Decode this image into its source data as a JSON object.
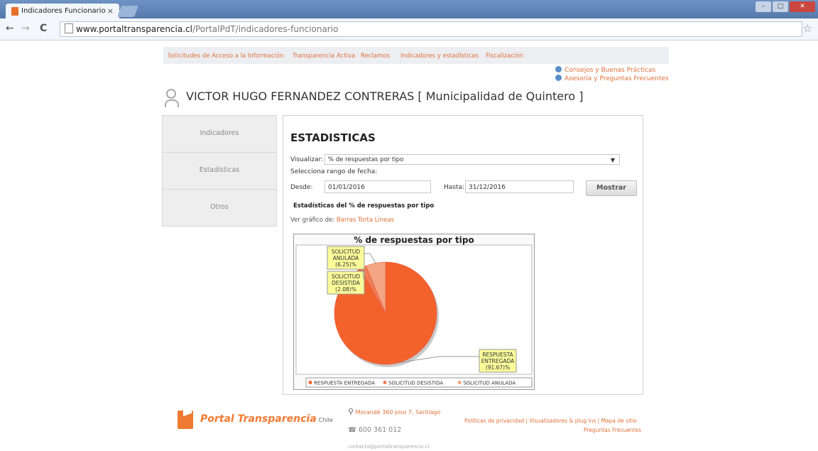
{
  "browser": {
    "tab_title": "Indicadores Funcionario",
    "tab_close": "×",
    "url_host": "www.portaltransparencia.cl",
    "url_path": "/PortalPdT/indicadores-funcionario",
    "back_icon": "←",
    "forward_icon": "→",
    "reload_icon": "C",
    "star_icon": "☆"
  },
  "menu": {
    "items": [
      "Solicitudes de Acceso a la Información",
      "Transparencia Activa",
      "Reclamos",
      "Indicadores y estadísticas",
      "Fiscalización"
    ]
  },
  "top_links": [
    "Consejos y Buenas Prácticas",
    "Asesoría y Preguntas Frecuentes"
  ],
  "user_name": "VICTOR HUGO FERNANDEZ CONTRERAS [ Municipalidad de Quintero ]",
  "side_menu": [
    "Indicadores",
    "Estadísticas",
    "Otros"
  ],
  "content": {
    "heading": "ESTADISTICAS",
    "visualizar_label": "Visualizar:",
    "visualizar_value": "% de respuestas por tipo",
    "rango_label": "Selecciona rango de fecha:",
    "desde_label": "Desde:",
    "desde_value": "01/01/2016",
    "hasta_label": "Hasta:",
    "hasta_value": "31/12/2016",
    "mostrar_button": "Mostrar",
    "subtitle": "Estadísticas del % de respuestas por tipo",
    "ver_label": "Ver gráfico de:",
    "ver_links": [
      "Barras",
      "Torta",
      "Lineas"
    ]
  },
  "chart_data": {
    "type": "pie",
    "title": "% de respuestas por tipo",
    "categories": [
      "RESPUESTA ENTREGADA",
      "SOLICITUD DESISTIDA",
      "SOLICITUD ANULADA"
    ],
    "values": [
      91.67,
      2.08,
      6.25
    ],
    "labels": [
      [
        "RESPUESTA",
        "ENTREGADA",
        "(91.67)%"
      ],
      [
        "SOLICITUD",
        "DESISTIDA",
        "(2.08)%"
      ],
      [
        "SOLICITUD",
        "ANULADA",
        "(6.25)%"
      ]
    ],
    "legend": [
      "RESPUESTA ENTREGADA",
      "SOLICITUD DESISTIDA",
      "SOLICITUD ANULADA"
    ],
    "legend_position": "bottom",
    "colors": [
      "#f4622c",
      "#f07d55",
      "#f3a584"
    ]
  },
  "footer": {
    "brand": "Portal Transparencia",
    "brand_country": "Chile",
    "address": "Morandé 360 piso 7, Santiago",
    "phone": "600 361 012",
    "email": "contacto@portaltransparencia.cl",
    "links": "Políticas de privacidad  |  Visualizadores & plug ins  |  Mapa de sitio",
    "link2": "Preguntas Frecuentes"
  }
}
